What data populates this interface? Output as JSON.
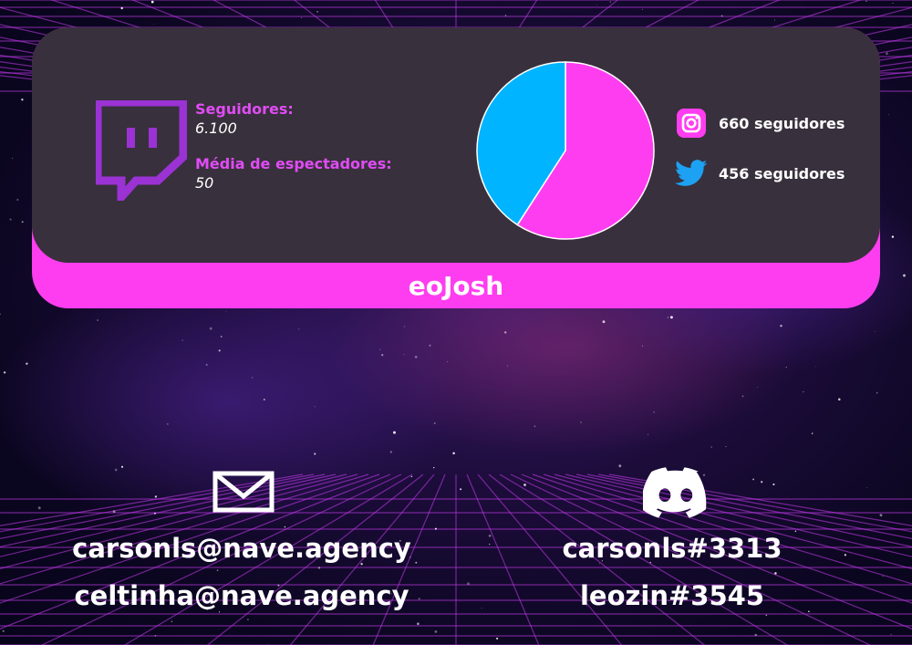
{
  "card": {
    "name": "eoJosh",
    "twitch": {
      "followers_label": "Seguidores:",
      "followers_value": "6.100",
      "viewers_label": "Média de espectadores:",
      "viewers_value": "50"
    },
    "socials": [
      {
        "icon": "instagram-icon",
        "text": "660 seguidores"
      },
      {
        "icon": "twitter-icon",
        "text": "456 seguidores"
      }
    ]
  },
  "chart_data": {
    "type": "pie",
    "slices": [
      {
        "label": "instagram",
        "value": 660,
        "color": "#ff3df0"
      },
      {
        "label": "twitter",
        "value": 456,
        "color": "#00b4ff"
      }
    ]
  },
  "contacts": {
    "email": {
      "icon": "mail-icon",
      "lines": [
        "carsonls@nave.agency",
        "celtinha@nave.agency"
      ]
    },
    "discord": {
      "icon": "discord-icon",
      "lines": [
        "carsonls#3313",
        "leozin#3545"
      ]
    }
  },
  "colors": {
    "accent": "#ff3df0",
    "twitch": "#9b32d4",
    "twitter": "#1da1f2"
  }
}
